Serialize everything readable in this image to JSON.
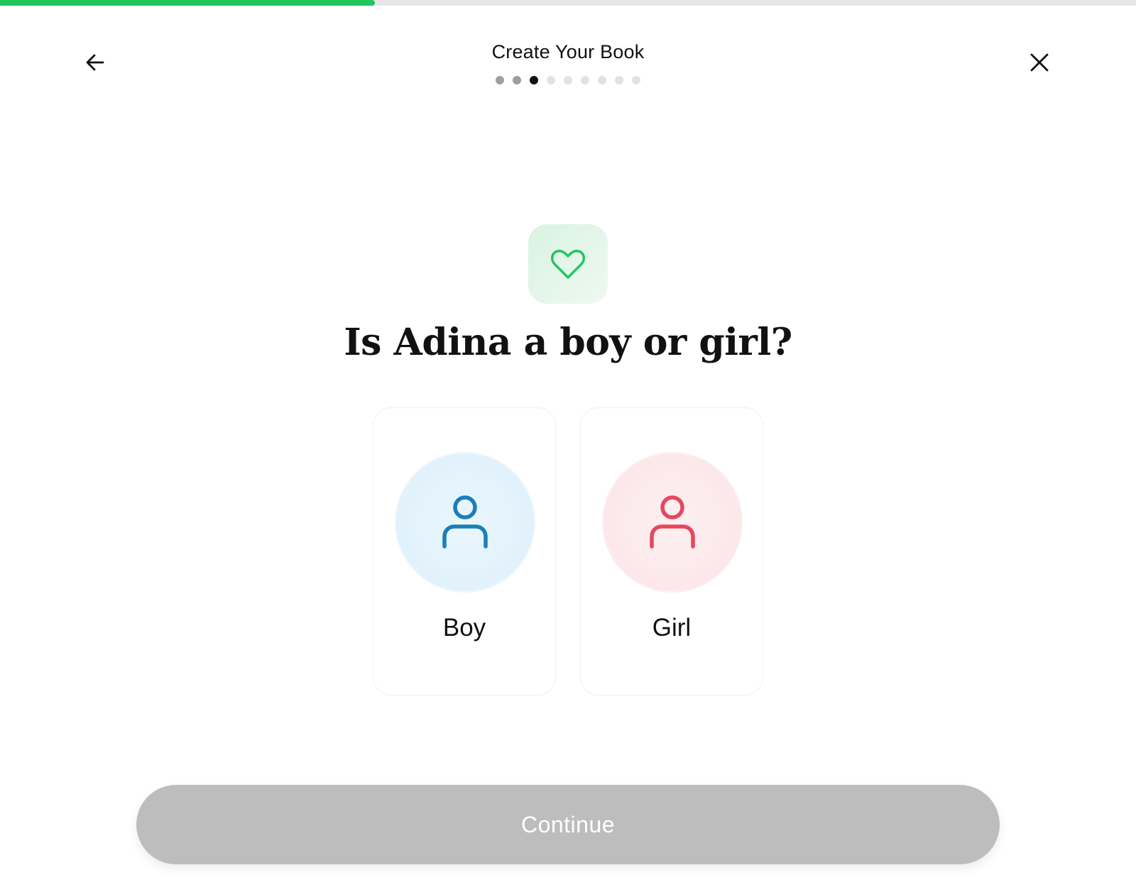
{
  "progress": {
    "fraction": 0.33,
    "color": "#22c55e"
  },
  "header": {
    "title": "Create Your Book",
    "back_icon": "arrow-left-icon",
    "close_icon": "close-icon"
  },
  "steps": {
    "total": 9,
    "current": 3
  },
  "hero": {
    "icon": "heart-icon",
    "accent": "#22c55e"
  },
  "question": "Is Adina a boy or girl?",
  "options": [
    {
      "label": "Boy",
      "icon": "person-icon",
      "color": "#1a7fb8"
    },
    {
      "label": "Girl",
      "icon": "person-icon",
      "color": "#e8465f"
    }
  ],
  "continue_label": "Continue"
}
